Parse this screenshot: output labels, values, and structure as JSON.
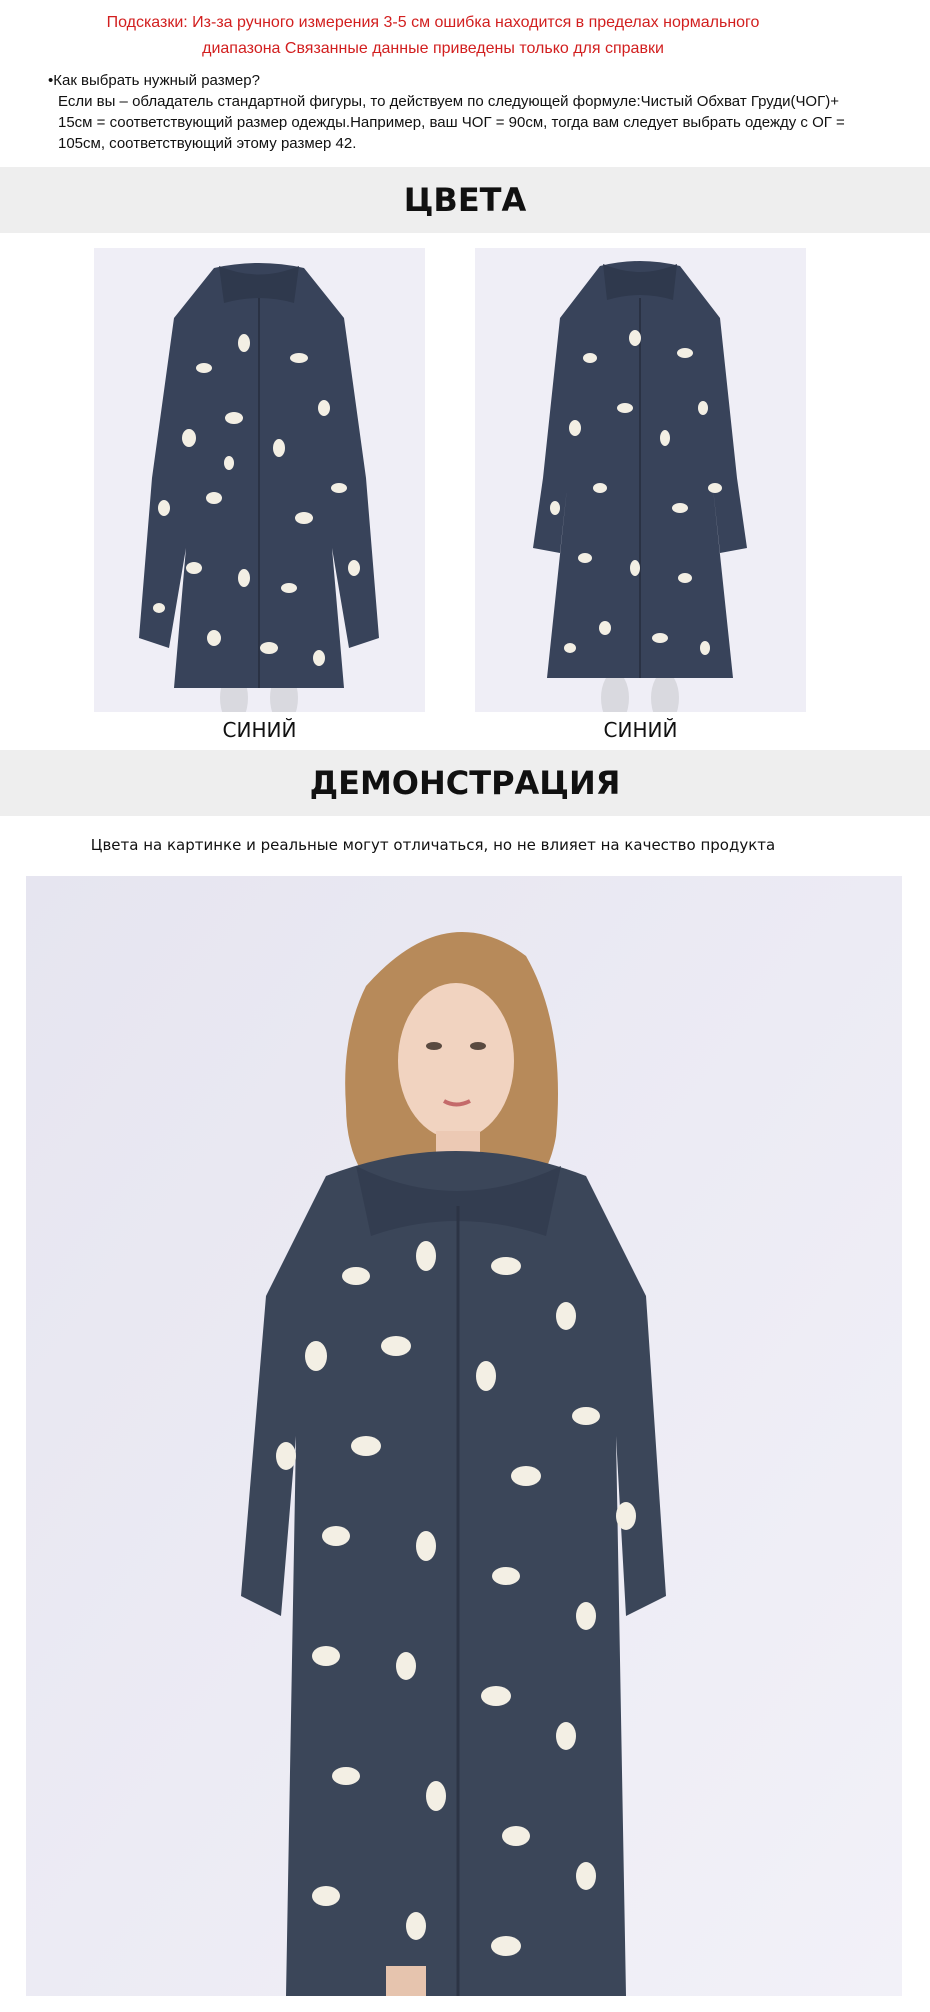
{
  "hints": {
    "line1": "Подсказки: Из-за ручного измерения 3-5 см ошибка находится в пределах нормального",
    "line2": "диапазона Связанные данные приведены только для справки"
  },
  "size_guide": {
    "question": "•Как выбрать нужный размер?",
    "body": "Если вы – обладатель стандартной фигуры, то действуем по следующей формуле:Чистый Обхват Груди(ЧОГ)+ 15см = соответствующий размер одежды.Например, ваш ЧОГ = 90см, тогда вам следует выбрать одежду с ОГ = 105см, соответствующий этому размер 42."
  },
  "colors_section": {
    "title": "ЦВЕТА",
    "items": [
      {
        "label": "СИНИЙ",
        "image": "blue-coat-front-photo"
      },
      {
        "label": "СИНИЙ",
        "image": "blue-coat-front-photo-2"
      }
    ]
  },
  "demo_section": {
    "title": "ДЕМОНСТРАЦИЯ",
    "note": "Цвета на картинке и реальные могут отличаться, но не влияет на качество продукта",
    "image": "model-wearing-coat-photo"
  },
  "theme": {
    "hint_color": "#d21f1f",
    "band_color": "#eeeeee",
    "coat_color": "#3b4659",
    "spot_color": "#f3efe4"
  }
}
